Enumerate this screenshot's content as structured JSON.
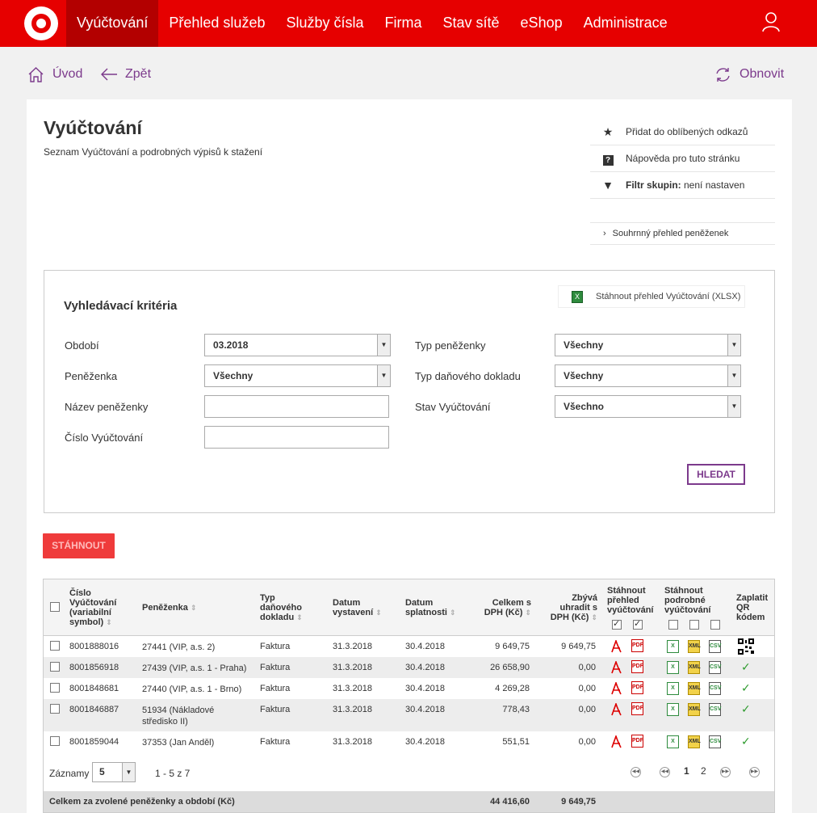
{
  "nav": {
    "items": [
      "Vyúčtování",
      "Přehled služeb",
      "Služby čísla",
      "Firma",
      "Stav sítě",
      "eShop",
      "Administrace"
    ]
  },
  "crumbs": {
    "home": "Úvod",
    "back": "Zpět",
    "refresh": "Obnovit"
  },
  "page": {
    "title": "Vyúčtování",
    "subtitle": "Seznam Vyúčtování a podrobných výpisů k stažení"
  },
  "side": {
    "fav": "Přidat do oblíbených odkazů",
    "help": "Nápověda pro tuto stránku",
    "filter_label": "Filtr skupin:",
    "filter_value": " není nastaven",
    "wallets": "Souhrnný přehled peněženek"
  },
  "filter": {
    "title": "Vyhledávací kritéria",
    "xlsx": "Stáhnout přehled Vyúčtování (XLSX)",
    "period_label": "Období",
    "period_value": "03.2018",
    "wallet_label": "Peněženka",
    "wallet_value": "Všechny",
    "wallet_name_label": "Název peněženky",
    "bill_no_label": "Číslo Vyúčtování",
    "wallet_type_label": "Typ peněženky",
    "wallet_type_value": "Všechny",
    "doc_type_label": "Typ daňového dokladu",
    "doc_type_value": "Všechny",
    "state_label": "Stav Vyúčtování",
    "state_value": "Všechno",
    "search": "HLEDAT"
  },
  "download": "STÁHNOUT",
  "table": {
    "headers": {
      "number": [
        "Číslo",
        "Vyúčtování",
        "(variabilní",
        "symbol)"
      ],
      "wallet": "Peněženka",
      "doctype": [
        "Typ",
        "daňového",
        "dokladu"
      ],
      "issued": [
        "Datum",
        "vystavení"
      ],
      "due": [
        "Datum",
        "splatnosti"
      ],
      "total": [
        "Celkem s",
        "DPH (Kč)"
      ],
      "remaining": [
        "Zbývá",
        "uhradit s",
        "DPH (Kč)"
      ],
      "summary": [
        "Stáhnout",
        "přehled",
        "vyúčtování"
      ],
      "detail": [
        "Stáhnout",
        "podrobné",
        "vyúčtování"
      ],
      "qr": [
        "Zaplatit",
        "QR",
        "kódem"
      ]
    },
    "rows": [
      {
        "number": "8001888016",
        "wallet": "27441 (VIP, a.s. 2)",
        "wallet2": "",
        "doctype": "Faktura",
        "issued": "31.3.2018",
        "due": "30.4.2018",
        "total": "9 649,75",
        "remaining": "9 649,75",
        "paid": false
      },
      {
        "number": "8001856918",
        "wallet": "27439 (VIP, a.s. 1 - Praha)",
        "wallet2": "",
        "doctype": "Faktura",
        "issued": "31.3.2018",
        "due": "30.4.2018",
        "total": "26 658,90",
        "remaining": "0,00",
        "paid": true
      },
      {
        "number": "8001848681",
        "wallet": "27440 (VIP, a.s. 1 - Brno)",
        "wallet2": "",
        "doctype": "Faktura",
        "issued": "31.3.2018",
        "due": "30.4.2018",
        "total": "4 269,28",
        "remaining": "0,00",
        "paid": true
      },
      {
        "number": "8001846887",
        "wallet": "51934 (Nákladové",
        "wallet2": "středisko II)",
        "doctype": "Faktura",
        "issued": "31.3.2018",
        "due": "30.4.2018",
        "total": "778,43",
        "remaining": "0,00",
        "paid": true
      },
      {
        "number": "8001859044",
        "wallet": "37353 (Jan Anděl)",
        "wallet2": "",
        "doctype": "Faktura",
        "issued": "31.3.2018",
        "due": "30.4.2018",
        "total": "551,51",
        "remaining": "0,00",
        "paid": true
      }
    ],
    "records_label": "Záznamy",
    "records_value": "5",
    "range": "1 - 5 z 7",
    "pages": [
      "1",
      "2"
    ],
    "sum_label": "Celkem za zvolené peněženky a období (Kč)",
    "sum_total": "44 416,60",
    "sum_remaining": "9 649,75"
  }
}
